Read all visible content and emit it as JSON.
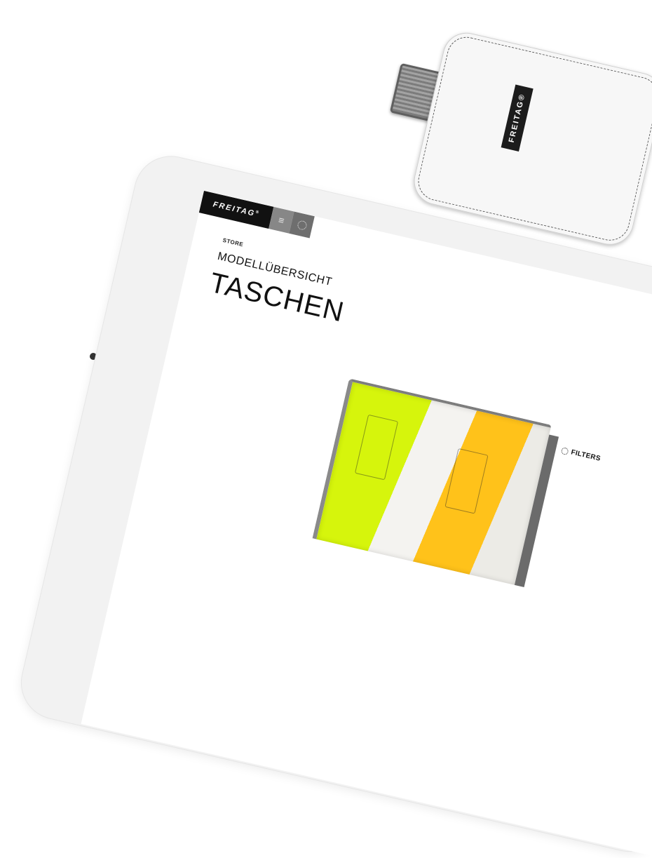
{
  "sleeve": {
    "brand": "FREITAG®"
  },
  "header": {
    "logo": "FREITAG",
    "logo_mark": "®",
    "menu_icon": "hamburger-icon",
    "language_icon": "globe-icon"
  },
  "page": {
    "breadcrumb": "STORE",
    "subtitle": "MODELLÜBERSICHT",
    "title": "TASCHEN"
  },
  "toolbar": {
    "filters_label": "FILTERS",
    "filters_icon": "filter-icon"
  },
  "colors": {
    "bar": "#111111",
    "menu": "#878787",
    "bag_yellow": "#d6f50c",
    "bag_orange": "#ffc21a"
  }
}
